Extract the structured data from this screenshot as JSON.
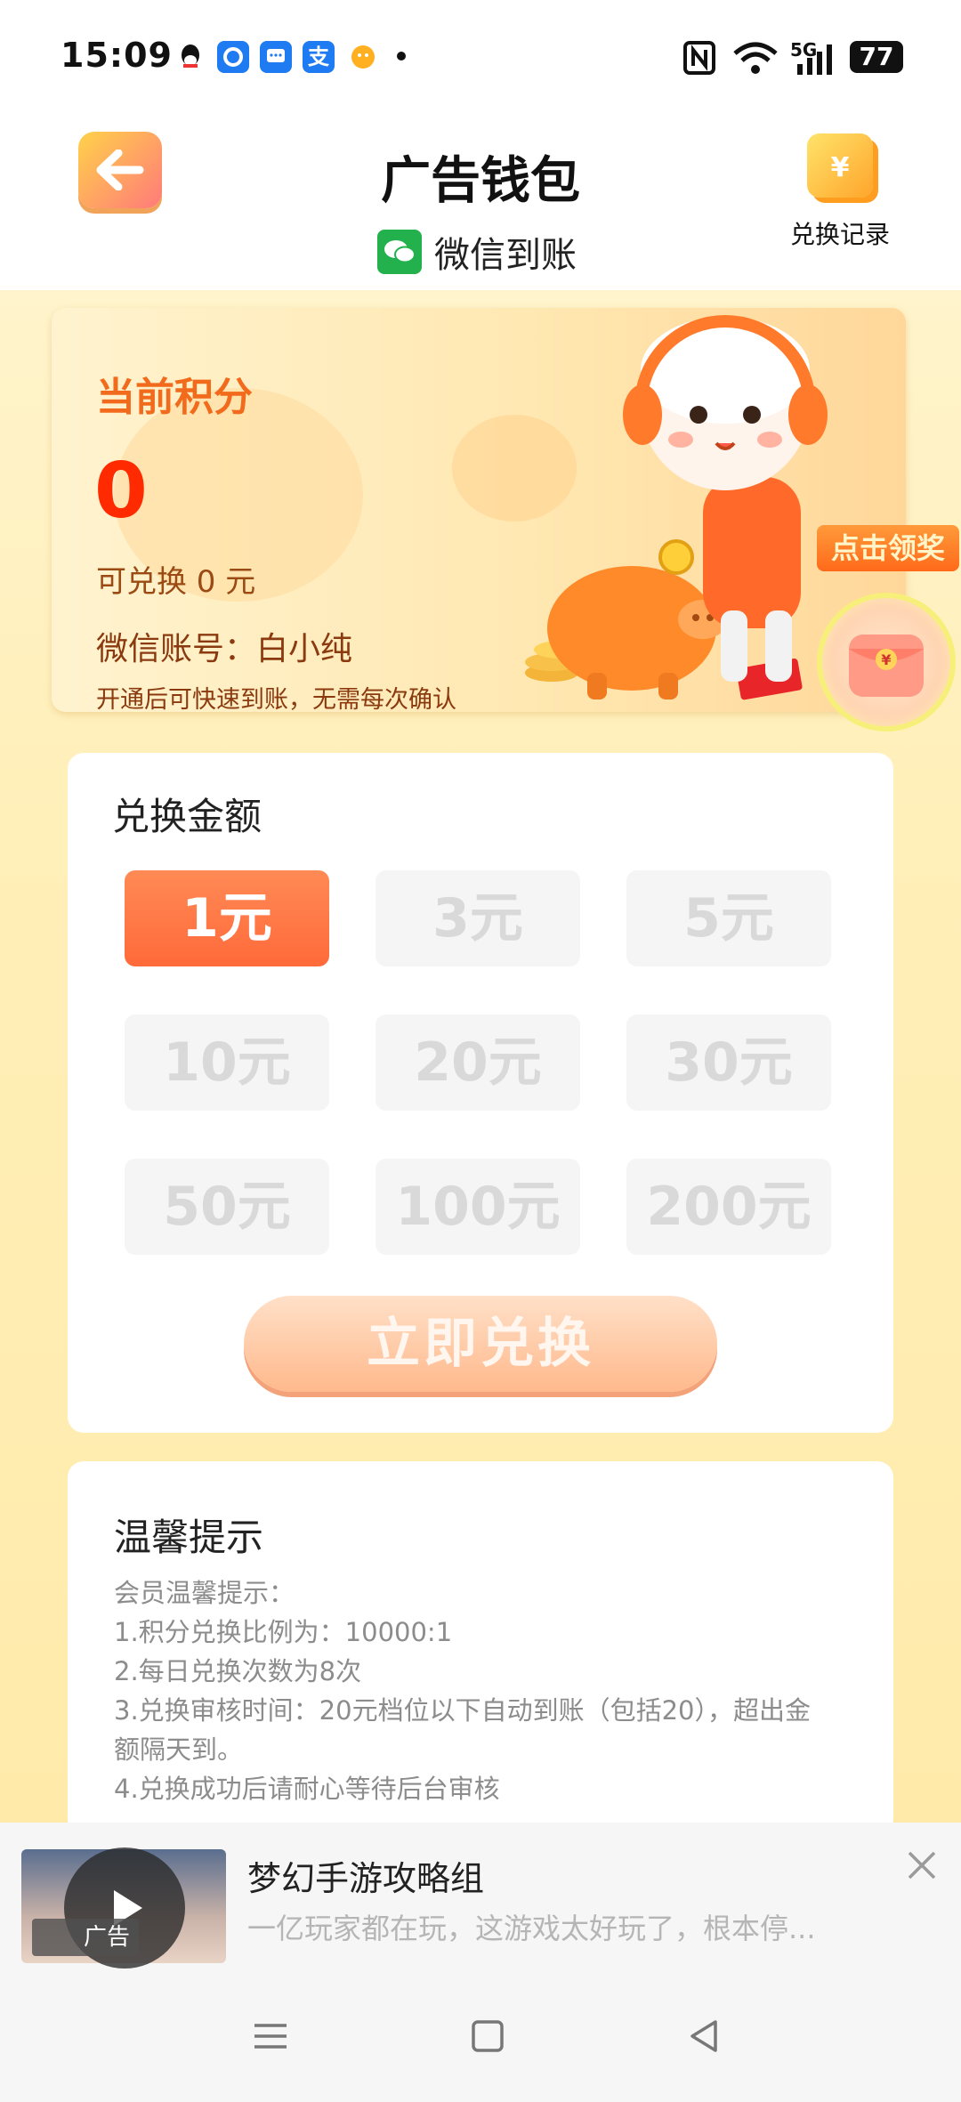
{
  "status_bar": {
    "time": "15:09",
    "network": "5G",
    "battery": "77",
    "notification_icons": [
      "qq-icon",
      "pinwheel-app-icon",
      "message-app-icon",
      "alipay-icon",
      "mascot-app-icon"
    ]
  },
  "header": {
    "title": "广告钱包",
    "subtitle": "微信到账",
    "records_label": "兑换记录"
  },
  "points_card": {
    "label": "当前积分",
    "value": "0",
    "convertible": "可兑换 0 元",
    "account": "微信账号：白小纯",
    "hint": "开通后可快速到账，无需每次确认"
  },
  "reward_float": {
    "label": "点击领奖"
  },
  "exchange": {
    "title": "兑换金额",
    "amounts": [
      "1元",
      "3元",
      "5元",
      "10元",
      "20元",
      "30元",
      "50元",
      "100元",
      "200元"
    ],
    "selected_index": 0,
    "button_label": "立即兑换"
  },
  "tips": {
    "title": "温馨提示",
    "lines": [
      "会员温馨提示：",
      "1.积分兑换比例为：10000:1",
      "2.每日兑换次数为8次",
      "3.兑换审核时间：20元档位以下自动到账（包括20），超出金",
      "额隔天到。",
      "4.兑换成功后请耐心等待后台审核"
    ]
  },
  "ad": {
    "tag": "广告",
    "title": "梦幻手游攻略组",
    "description": "一亿玩家都在玩，这游戏太好玩了，根本停..."
  },
  "colors": {
    "accent": "#ff6a3a",
    "title_orange": "#f26a1b",
    "points_red": "#ff2a00",
    "wechat_green": "#22b14c"
  }
}
